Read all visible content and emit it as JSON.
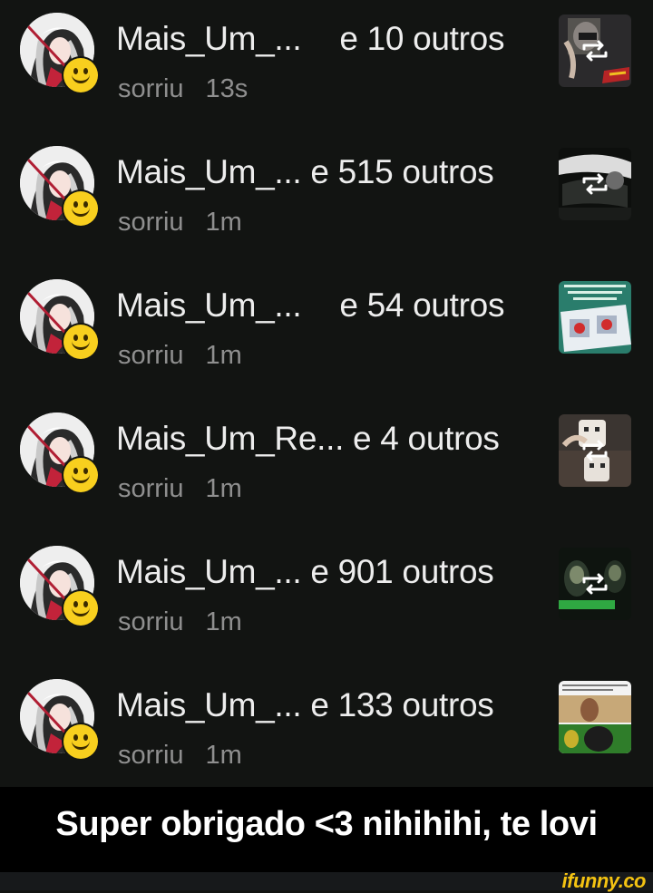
{
  "notifications": [
    {
      "name": "Mais_Um_...",
      "others": "e 10 outros",
      "action": "sorriu",
      "time": "13s"
    },
    {
      "name": "Mais_Um_...",
      "others": "e 515 outros",
      "action": "sorriu",
      "time": "1m"
    },
    {
      "name": "Mais_Um_...",
      "others": "e 54 outros",
      "action": "sorriu",
      "time": "1m"
    },
    {
      "name": "Mais_Um_Re...",
      "others": "e 4 outros",
      "action": "sorriu",
      "time": "1m"
    },
    {
      "name": "Mais_Um_...",
      "others": "e 901 outros",
      "action": "sorriu",
      "time": "1m"
    },
    {
      "name": "Mais_Um_...",
      "others": "e 133 outros",
      "action": "sorriu",
      "time": "1m"
    }
  ],
  "caption": "Super obrigado <3 nihihihi, te lovi",
  "watermark": "ifunny.co",
  "icons": {
    "reaction": "smile-emoji-icon",
    "repost": "repost-icon"
  },
  "colors": {
    "background": "#121412",
    "text": "#ededed",
    "muted": "#8f8f8f",
    "emoji": "#f8cf1e",
    "watermark": "#f4c312"
  }
}
